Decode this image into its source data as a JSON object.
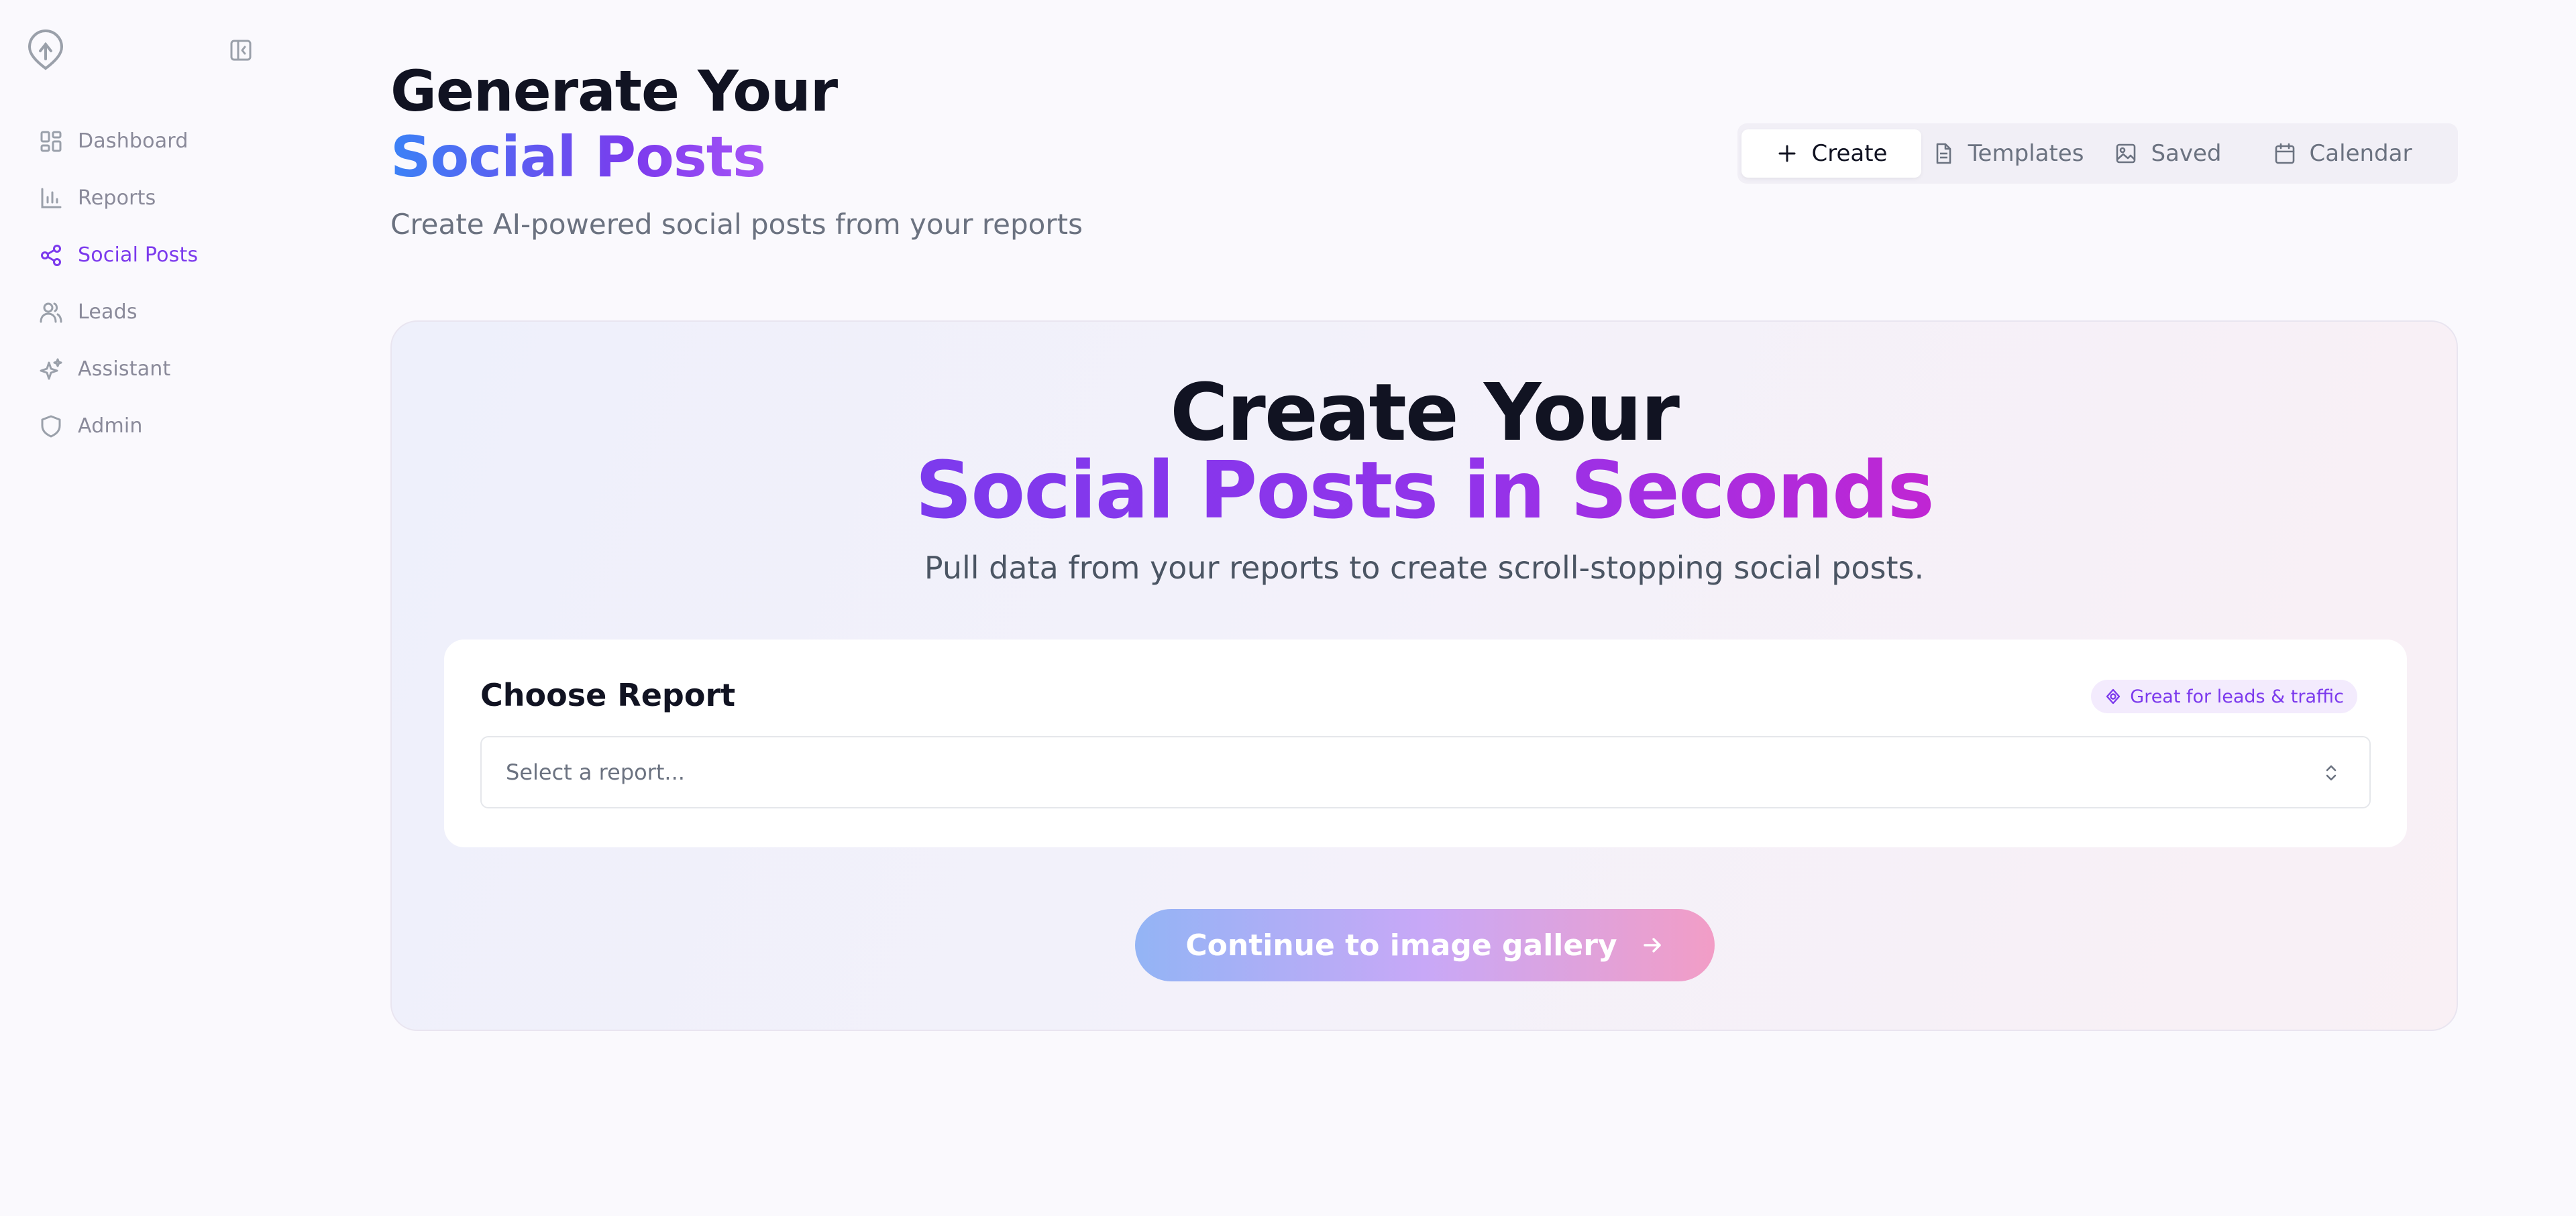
{
  "sidebar": {
    "logo_icon": "brand-logo-icon",
    "collapse_icon": "sidebar-collapse-icon",
    "items": [
      {
        "label": "Dashboard",
        "icon": "dashboard-icon",
        "active": false
      },
      {
        "label": "Reports",
        "icon": "bar-chart-icon",
        "active": false
      },
      {
        "label": "Social Posts",
        "icon": "share-icon",
        "active": true
      },
      {
        "label": "Leads",
        "icon": "users-icon",
        "active": false
      },
      {
        "label": "Assistant",
        "icon": "sparkles-icon",
        "active": false
      },
      {
        "label": "Admin",
        "icon": "shield-icon",
        "active": false
      }
    ],
    "active_color": "#7c3aed"
  },
  "header": {
    "title_line1": "Generate Your",
    "title_line2": "Social Posts",
    "subtitle": "Create AI-powered social posts from your reports"
  },
  "tabs": [
    {
      "label": "Create",
      "icon": "plus-icon",
      "active": true
    },
    {
      "label": "Templates",
      "icon": "document-icon",
      "active": false
    },
    {
      "label": "Saved",
      "icon": "image-icon",
      "active": false
    },
    {
      "label": "Calendar",
      "icon": "calendar-icon",
      "active": false
    }
  ],
  "hero": {
    "line1": "Create Your",
    "line2": "Social Posts in Seconds",
    "subtitle": "Pull data from your reports to create scroll-stopping social posts."
  },
  "report_panel": {
    "title": "Choose Report",
    "badge": "Great for leads & traffic",
    "badge_icon": "target-icon",
    "select_placeholder": "Select a report...",
    "select_icon": "chevron-up-down-icon"
  },
  "cta": {
    "label": "Continue to image gallery",
    "icon": "arrow-right-icon"
  },
  "colors": {
    "accent": "#7c3aed",
    "title_gradient": [
      "#3b82f6",
      "#7c3aed",
      "#a855f7"
    ],
    "hero_gradient": [
      "#7c3aed",
      "#9333ea",
      "#c026d3"
    ],
    "cta_gradient": [
      "#93b4f5",
      "#c8a8f7",
      "#f29dc6"
    ]
  }
}
